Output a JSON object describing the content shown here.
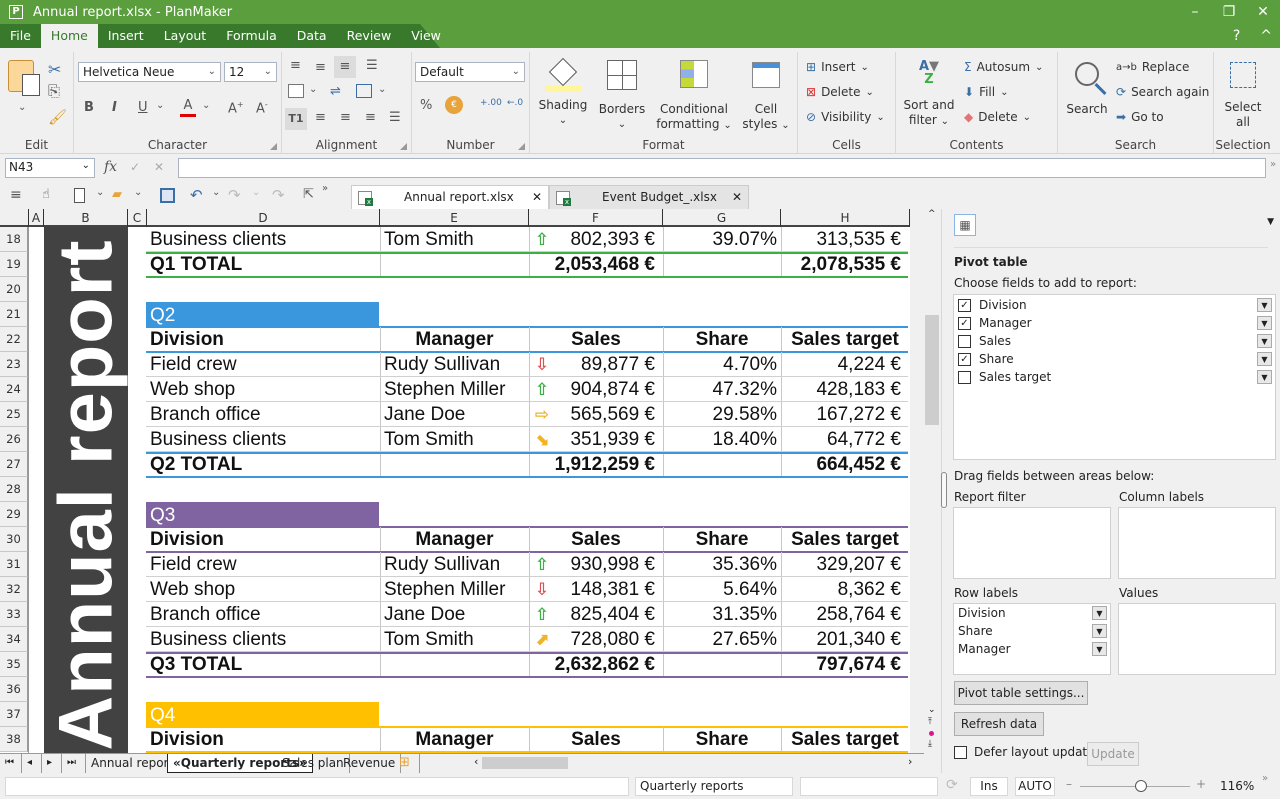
{
  "window": {
    "title": "Annual report.xlsx - PlanMaker",
    "app_icon": "P",
    "minimize": "–",
    "restore": "❐",
    "close": "✕"
  },
  "menu": {
    "items": [
      "File",
      "Home",
      "Insert",
      "Layout",
      "Formula",
      "Data",
      "Review",
      "View"
    ],
    "active": "Home",
    "help": "?",
    "collapse": "^"
  },
  "ribbon": {
    "edit": {
      "label": "Edit"
    },
    "character": {
      "label": "Character",
      "font": "Helvetica Neue",
      "size": "12",
      "bold": "B",
      "italic": "I",
      "underline": "U",
      "font_color": "A",
      "grow": "A",
      "shrink": "A",
      "font_color_hex": "#e00000"
    },
    "alignment": {
      "label": "Alignment"
    },
    "number": {
      "label": "Number",
      "format": "Default",
      "percent": "%",
      "inc_dec": ".00",
      "dec_dec": ".0"
    },
    "format": {
      "label": "Format",
      "shading": "Shading",
      "borders": "Borders",
      "conditional1": "Conditional",
      "conditional2": "formatting",
      "cellstyles1": "Cell",
      "cellstyles2": "styles",
      "shading_color": "#fff59d"
    },
    "cells": {
      "label": "Cells",
      "insert": "Insert",
      "delete": "Delete",
      "visibility": "Visibility"
    },
    "contents": {
      "label": "Contents",
      "sort1": "Sort and",
      "sort2": "filter",
      "autosum": "Autosum",
      "fill": "Fill",
      "delete": "Delete"
    },
    "search": {
      "label": "Search",
      "search": "Search",
      "replace": "Replace",
      "search_again": "Search again",
      "goto": "Go to"
    },
    "selection": {
      "label": "Selection",
      "select1": "Select",
      "select2": "all"
    }
  },
  "formula_bar": {
    "cell_ref": "N43",
    "fx": "fx",
    "accept": "✓",
    "cancel": "✕",
    "value": ""
  },
  "doc_tabs": [
    {
      "label": "Annual report.xlsx",
      "active": true
    },
    {
      "label": "Event Budget_.xlsx",
      "active": false
    }
  ],
  "columns": [
    "A",
    "B",
    "C",
    "D",
    "E",
    "F",
    "G",
    "H"
  ],
  "banner": {
    "text": "Annual report"
  },
  "sheet": {
    "q1_tail": {
      "row": {
        "num": "18",
        "division": "Business clients",
        "manager": "Tom Smith",
        "trend": "up",
        "sales": "802,393 €",
        "share": "39.07%",
        "target": "313,535 €"
      },
      "total": {
        "num": "19",
        "label": "Q1 TOTAL",
        "sales": "2,053,468 €",
        "target": "2,078,535 €"
      },
      "color": "#3cb043"
    },
    "quarters": [
      {
        "title": "Q2",
        "color": "#3a96dd",
        "title_row": "21",
        "header_row": "22",
        "rows": [
          {
            "num": "23",
            "division": "Field crew",
            "manager": "Rudy Sullivan",
            "trend": "down",
            "sales": "89,877 €",
            "share": "4.70%",
            "target": "4,224 €"
          },
          {
            "num": "24",
            "division": "Web shop",
            "manager": "Stephen Miller",
            "trend": "up",
            "sales": "904,874 €",
            "share": "47.32%",
            "target": "428,183 €"
          },
          {
            "num": "25",
            "division": "Branch office",
            "manager": "Jane Doe",
            "trend": "right",
            "sales": "565,569 €",
            "share": "29.58%",
            "target": "167,272 €"
          },
          {
            "num": "26",
            "division": "Business clients",
            "manager": "Tom Smith",
            "trend": "down-right",
            "sales": "351,939 €",
            "share": "18.40%",
            "target": "64,772 €"
          }
        ],
        "total": {
          "num": "27",
          "label": "Q2 TOTAL",
          "sales": "1,912,259 €",
          "target": "664,452 €"
        }
      },
      {
        "title": "Q3",
        "color": "#8064a2",
        "title_row": "29",
        "header_row": "30",
        "rows": [
          {
            "num": "31",
            "division": "Field crew",
            "manager": "Rudy Sullivan",
            "trend": "up",
            "sales": "930,998 €",
            "share": "35.36%",
            "target": "329,207 €"
          },
          {
            "num": "32",
            "division": "Web shop",
            "manager": "Stephen Miller",
            "trend": "down",
            "sales": "148,381 €",
            "share": "5.64%",
            "target": "8,362 €"
          },
          {
            "num": "33",
            "division": "Branch office",
            "manager": "Jane Doe",
            "trend": "up",
            "sales": "825,404 €",
            "share": "31.35%",
            "target": "258,764 €"
          },
          {
            "num": "34",
            "division": "Business clients",
            "manager": "Tom Smith",
            "trend": "up-right",
            "sales": "728,080 €",
            "share": "27.65%",
            "target": "201,340 €"
          }
        ],
        "total": {
          "num": "35",
          "label": "Q3 TOTAL",
          "sales": "2,632,862 €",
          "target": "797,674 €"
        }
      },
      {
        "title": "Q4",
        "color": "#ffc000",
        "title_row": "37",
        "header_row": "38",
        "rows": [],
        "total": null
      }
    ],
    "headers": {
      "division": "Division",
      "manager": "Manager",
      "sales": "Sales",
      "share": "Share",
      "target": "Sales target"
    },
    "empty_rows": [
      "20",
      "28",
      "36"
    ]
  },
  "sheet_tabs": [
    {
      "label": "Annual report",
      "active": false
    },
    {
      "label": "«Quarterly reports»",
      "active": true
    },
    {
      "label": "Sales plan",
      "active": false
    },
    {
      "label": "Revenue",
      "active": false
    }
  ],
  "pivot": {
    "title": "Pivot table",
    "choose_label": "Choose fields to add to report:",
    "fields": [
      {
        "label": "Division",
        "checked": true
      },
      {
        "label": "Manager",
        "checked": true
      },
      {
        "label": "Sales",
        "checked": false
      },
      {
        "label": "Share",
        "checked": true
      },
      {
        "label": "Sales target",
        "checked": false
      }
    ],
    "drag_label": "Drag fields between areas below:",
    "report_filter": "Report filter",
    "column_labels": "Column labels",
    "row_labels": "Row labels",
    "values": "Values",
    "row_items": [
      "Division",
      "Share",
      "Manager"
    ],
    "settings_btn": "Pivot table settings...",
    "refresh_btn": "Refresh data",
    "defer_label": "Defer layout update",
    "defer_checked": false,
    "update_btn": "Update"
  },
  "status": {
    "sheet_name": "Quarterly reports",
    "ins": "Ins",
    "mode": "AUTO",
    "zoom": "116%",
    "zoom_fraction": 0.55
  }
}
